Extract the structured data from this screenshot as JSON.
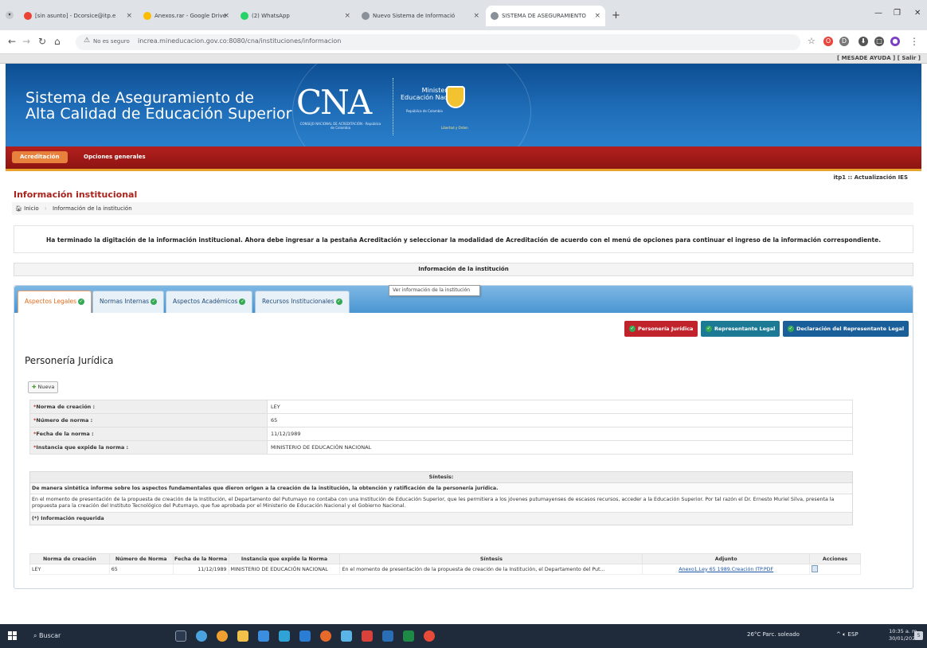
{
  "browser": {
    "tabs": [
      {
        "title": "[sin asunto] - Dcorsice@itp.e",
        "icon_color": "#ea4335",
        "active": false
      },
      {
        "title": "Anexos.rar - Google Drive",
        "icon_color": "#fbbc04",
        "active": false
      },
      {
        "title": "(2) WhatsApp",
        "icon_color": "#25d366",
        "active": false
      },
      {
        "title": "Nuevo Sistema de Informació",
        "icon_color": "#5f6368",
        "active": false
      },
      {
        "title": "SISTEMA DE ASEGURAMIENTO",
        "icon_color": "#5f6368",
        "active": true
      }
    ],
    "new_tab": "+",
    "close_glyph": "×",
    "insecure_label": "No es seguro",
    "url": "increa.mineducacion.gov.co:8080/cna/instituciones/informacion",
    "extensions": [
      "O",
      "D",
      "⬇",
      "□",
      "●"
    ]
  },
  "topstrip": {
    "help": "[ MESADE AYUDA ]",
    "exit": "[ Salir ]"
  },
  "banner": {
    "title_line1": "Sistema de Aseguramiento de",
    "title_line2": "Alta Calidad de Educación Superior",
    "logo": "CNA",
    "logo_sub": "CONSEJO NACIONAL DE ACREDITACIÓN · República de Colombia",
    "ministry_line1": "Ministerio de",
    "ministry_line2": "Educación Nacional",
    "ministry_sub": "República de Colombia",
    "motto": "Libertad y Orden"
  },
  "menu": {
    "items": [
      "Acreditación",
      "Opciones generales"
    ]
  },
  "version": "itp1 :: Actualización IES",
  "page": {
    "title": "Información institucional",
    "breadcrumb_home": "Inicio",
    "breadcrumb_current": "Información de la institución",
    "notice": "Ha terminado la digitación de la información institucional. Ahora debe ingresar a la pestaña Acreditación y seleccionar la modalidad de Acreditación de acuerdo con el menú de opciones para continuar el ingreso de la información correspondiente.",
    "info_bar": "Información de la institución",
    "tooltip": "Ver información de la institución"
  },
  "panel_tabs": [
    {
      "label": "Aspectos Legales",
      "active": true
    },
    {
      "label": "Normas Internas",
      "active": false
    },
    {
      "label": "Aspectos Académicos",
      "active": false
    },
    {
      "label": "Recursos Institucionales",
      "active": false
    }
  ],
  "actions": {
    "personeria": "Personería Jurídica",
    "representante": "Representante Legal",
    "declaracion": "Declaración del Representante Legal"
  },
  "section": {
    "title": "Personería Jurídica",
    "new_button": "Nueva"
  },
  "form": {
    "rows": [
      {
        "label": "Norma de creación :",
        "value": "LEY"
      },
      {
        "label": "Número de norma :",
        "value": "65"
      },
      {
        "label": "Fecha de la norma :",
        "value": "11/12/1989"
      },
      {
        "label": "Instancia que expide la norma :",
        "value": "MINISTERIO DE EDUCACIÓN NACIONAL"
      }
    ]
  },
  "sintesis": {
    "header": "Síntesis:",
    "question": "De manera sintética informe sobre los aspectos fundamentales que dieron origen a la creación de la institución, la obtención y ratificación de la personería jurídica.",
    "text": "En el momento de presentación de la propuesta de creación de la Institución, el Departamento del Putumayo no contaba con una Institución de Educación Superior, que les permitiera a los jóvenes putumayenses de escasos recursos, acceder a la Educación Superior. Por tal razón el Dr. Ernesto Muriel Silva, presenta la propuesta para la creación del Instituto Tecnológico del Putumayo, que fue aprobada por el Ministerio de Educación Nacional y el Gobierno Nacional.",
    "required": "(*) Información requerida"
  },
  "grid": {
    "headers": [
      "Norma de creación",
      "Número de Norma",
      "Fecha de la Norma",
      "Instancia que expide la Norma",
      "Síntesis",
      "Adjunto",
      "Acciones"
    ],
    "rows": [
      {
        "norma": "LEY",
        "numero": "65",
        "fecha": "11/12/1989",
        "instancia": "MINISTERIO DE EDUCACIÓN NACIONAL",
        "sintesis": "En el momento de presentación de la propuesta de creación de la Institución, el Departamento del Put...",
        "adjunto": "Anexo1.Ley 65 1989.Creación ITP.PDF"
      }
    ]
  },
  "taskbar": {
    "search": "Buscar",
    "weather": "26°C  Parc. soleado",
    "lang": "ESP",
    "time": "10:35 a. m.",
    "date": "30/01/2024"
  }
}
